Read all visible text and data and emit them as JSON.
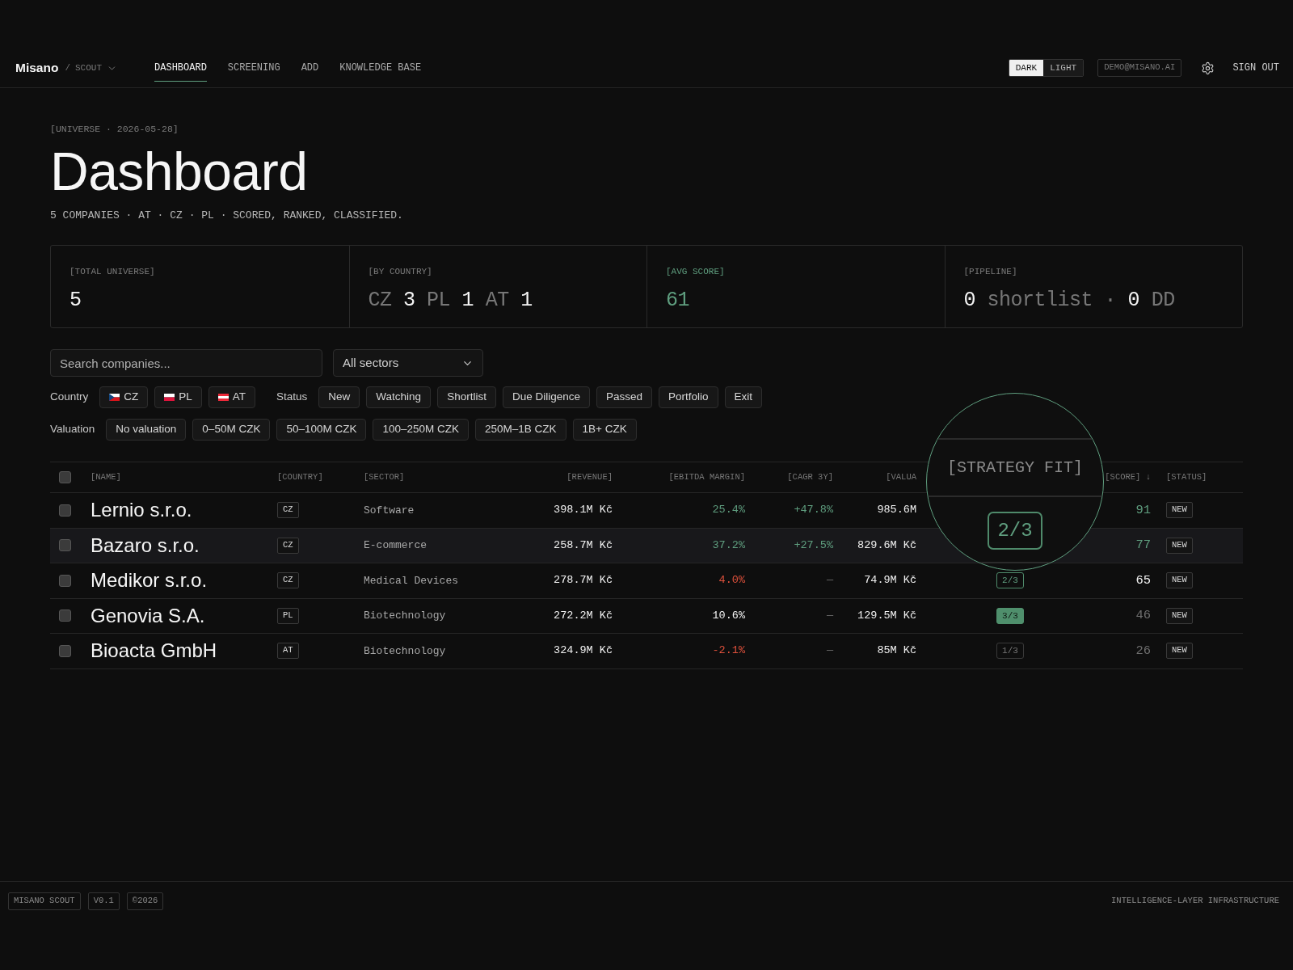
{
  "header": {
    "logo": "Misano",
    "separator": "/",
    "product": "SCOUT",
    "nav": [
      {
        "label": "DASHBOARD",
        "selected": true
      },
      {
        "label": "SCREENING",
        "selected": false
      },
      {
        "label": "ADD",
        "selected": false
      },
      {
        "label": "KNOWLEDGE BASE",
        "selected": false
      }
    ],
    "theme_toggle": [
      {
        "label": "DARK",
        "selected": true
      },
      {
        "label": "LIGHT",
        "selected": false
      }
    ],
    "user_email": "DEMO@MISANO.AI",
    "sign_out": "SIGN OUT"
  },
  "page": {
    "eyebrow": "[UNIVERSE · 2026-05-28]",
    "title": "Dashboard",
    "subtitle": "5 COMPANIES · AT · CZ · PL · SCORED, RANKED, CLASSIFIED."
  },
  "stats": [
    {
      "label": "[TOTAL UNIVERSE]",
      "accent": false,
      "value": [
        {
          "text": "5",
          "kind": "bright"
        }
      ]
    },
    {
      "label": "[BY COUNTRY]",
      "accent": false,
      "value": [
        {
          "text": "CZ",
          "kind": "dim"
        },
        {
          "text": "3",
          "kind": "bright"
        },
        {
          "text": "PL",
          "kind": "dim"
        },
        {
          "text": "1",
          "kind": "bright"
        },
        {
          "text": "AT",
          "kind": "dim"
        },
        {
          "text": "1",
          "kind": "bright"
        }
      ]
    },
    {
      "label": "[AVG SCORE]",
      "accent": true,
      "value": [
        {
          "text": "61",
          "kind": "accent"
        }
      ]
    },
    {
      "label": "[PIPELINE]",
      "accent": false,
      "value": [
        {
          "text": "0",
          "kind": "bright"
        },
        {
          "text": "shortlist",
          "kind": "dim"
        },
        {
          "text": "·",
          "kind": "dim"
        },
        {
          "text": "0",
          "kind": "bright"
        },
        {
          "text": "DD",
          "kind": "dim"
        }
      ]
    }
  ],
  "filters": {
    "search": {
      "placeholder": "Search companies..."
    },
    "sector": {
      "value": "All sectors"
    },
    "rows": [
      [
        {
          "label": "Country",
          "chips": [
            {
              "label": "CZ",
              "kind": "cz",
              "selected": false
            },
            {
              "label": "PL",
              "kind": "pl",
              "selected": false
            },
            {
              "label": "AT",
              "kind": "at",
              "selected": false
            }
          ]
        },
        {
          "label": "Status",
          "chips": [
            {
              "label": "New",
              "selected": false
            },
            {
              "label": "Watching",
              "selected": false
            },
            {
              "label": "Shortlist",
              "selected": false
            },
            {
              "label": "Due Diligence",
              "selected": false
            },
            {
              "label": "Passed",
              "selected": false
            },
            {
              "label": "Portfolio",
              "selected": false
            },
            {
              "label": "Exit",
              "selected": false
            }
          ]
        }
      ],
      [
        {
          "label": "Valuation",
          "chips": [
            {
              "label": "No valuation",
              "selected": false
            },
            {
              "label": "0–50M CZK",
              "selected": false
            },
            {
              "label": "50–100M CZK",
              "selected": false
            },
            {
              "label": "100–250M CZK",
              "selected": false
            },
            {
              "label": "250M–1B CZK",
              "selected": false
            },
            {
              "label": "1B+ CZK",
              "selected": false
            }
          ]
        }
      ]
    ]
  },
  "table": {
    "header_checkbox": {
      "checked": false
    },
    "columns": {
      "name": "[NAME]",
      "country": "[COUNTRY]",
      "sector": "[SECTOR]",
      "revenue": "[REVENUE]",
      "ebitda_margin": "[EBITDA MARGIN]",
      "cagr_3y": "[CAGR 3Y]",
      "valuation": "[VALUA",
      "score": "[SCORE] ↓",
      "status": "[STATUS]"
    },
    "rows": [
      {
        "checked": false,
        "highlighted": false,
        "name": "Lernio s.r.o.",
        "country": "CZ",
        "sector": "Software",
        "revenue": "398.1M Kč",
        "ebitda_margin": {
          "text": "25.4%",
          "kind": "positive"
        },
        "cagr_3y": {
          "text": "+47.8%",
          "kind": "positive"
        },
        "valuation": "985.6M",
        "score": {
          "text": "91",
          "kind": "positive"
        },
        "status": "NEW"
      },
      {
        "checked": false,
        "highlighted": true,
        "name": "Bazaro s.r.o.",
        "country": "CZ",
        "sector": "E-commerce",
        "revenue": "258.7M Kč",
        "ebitda_margin": {
          "text": "37.2%",
          "kind": "positive"
        },
        "cagr_3y": {
          "text": "+27.5%",
          "kind": "positive"
        },
        "valuation": "829.6M Kč",
        "score": {
          "text": "77",
          "kind": "positive"
        },
        "status": "NEW"
      },
      {
        "checked": false,
        "highlighted": false,
        "name": "Medikor s.r.o.",
        "country": "CZ",
        "sector": "Medical Devices",
        "revenue": "278.7M Kč",
        "ebitda_margin": {
          "text": "4.0%",
          "kind": "negative"
        },
        "cagr_3y": {
          "text": "—",
          "kind": "muted"
        },
        "valuation": "74.9M Kč",
        "strategy_fit": {
          "text": "2/3",
          "kind": "partial"
        },
        "score": {
          "text": "65",
          "kind": "neutral"
        },
        "status": "NEW"
      },
      {
        "checked": false,
        "highlighted": false,
        "name": "Genovia S.A.",
        "country": "PL",
        "sector": "Biotechnology",
        "revenue": "272.2M Kč",
        "ebitda_margin": {
          "text": "10.6%",
          "kind": "neutral"
        },
        "cagr_3y": {
          "text": "—",
          "kind": "muted"
        },
        "valuation": "129.5M Kč",
        "strategy_fit": {
          "text": "3/3",
          "kind": "full"
        },
        "score": {
          "text": "46",
          "kind": "muted"
        },
        "status": "NEW"
      },
      {
        "checked": false,
        "highlighted": false,
        "name": "Bioacta GmbH",
        "country": "AT",
        "sector": "Biotechnology",
        "revenue": "324.9M Kč",
        "ebitda_margin": {
          "text": "-2.1%",
          "kind": "negative"
        },
        "cagr_3y": {
          "text": "—",
          "kind": "muted"
        },
        "valuation": "85M Kč",
        "strategy_fit": {
          "text": "1/3",
          "kind": "weak"
        },
        "score": {
          "text": "26",
          "kind": "muted"
        },
        "status": "NEW"
      }
    ]
  },
  "magnifier": {
    "header": "[STRATEGY FIT]",
    "badge": {
      "text": "2/3",
      "kind": "partial"
    }
  },
  "footer": {
    "badges": [
      "MISANO SCOUT",
      "V0.1",
      "©2026"
    ],
    "tagline": "INTELLIGENCE-LAYER INFRASTRUCTURE"
  }
}
